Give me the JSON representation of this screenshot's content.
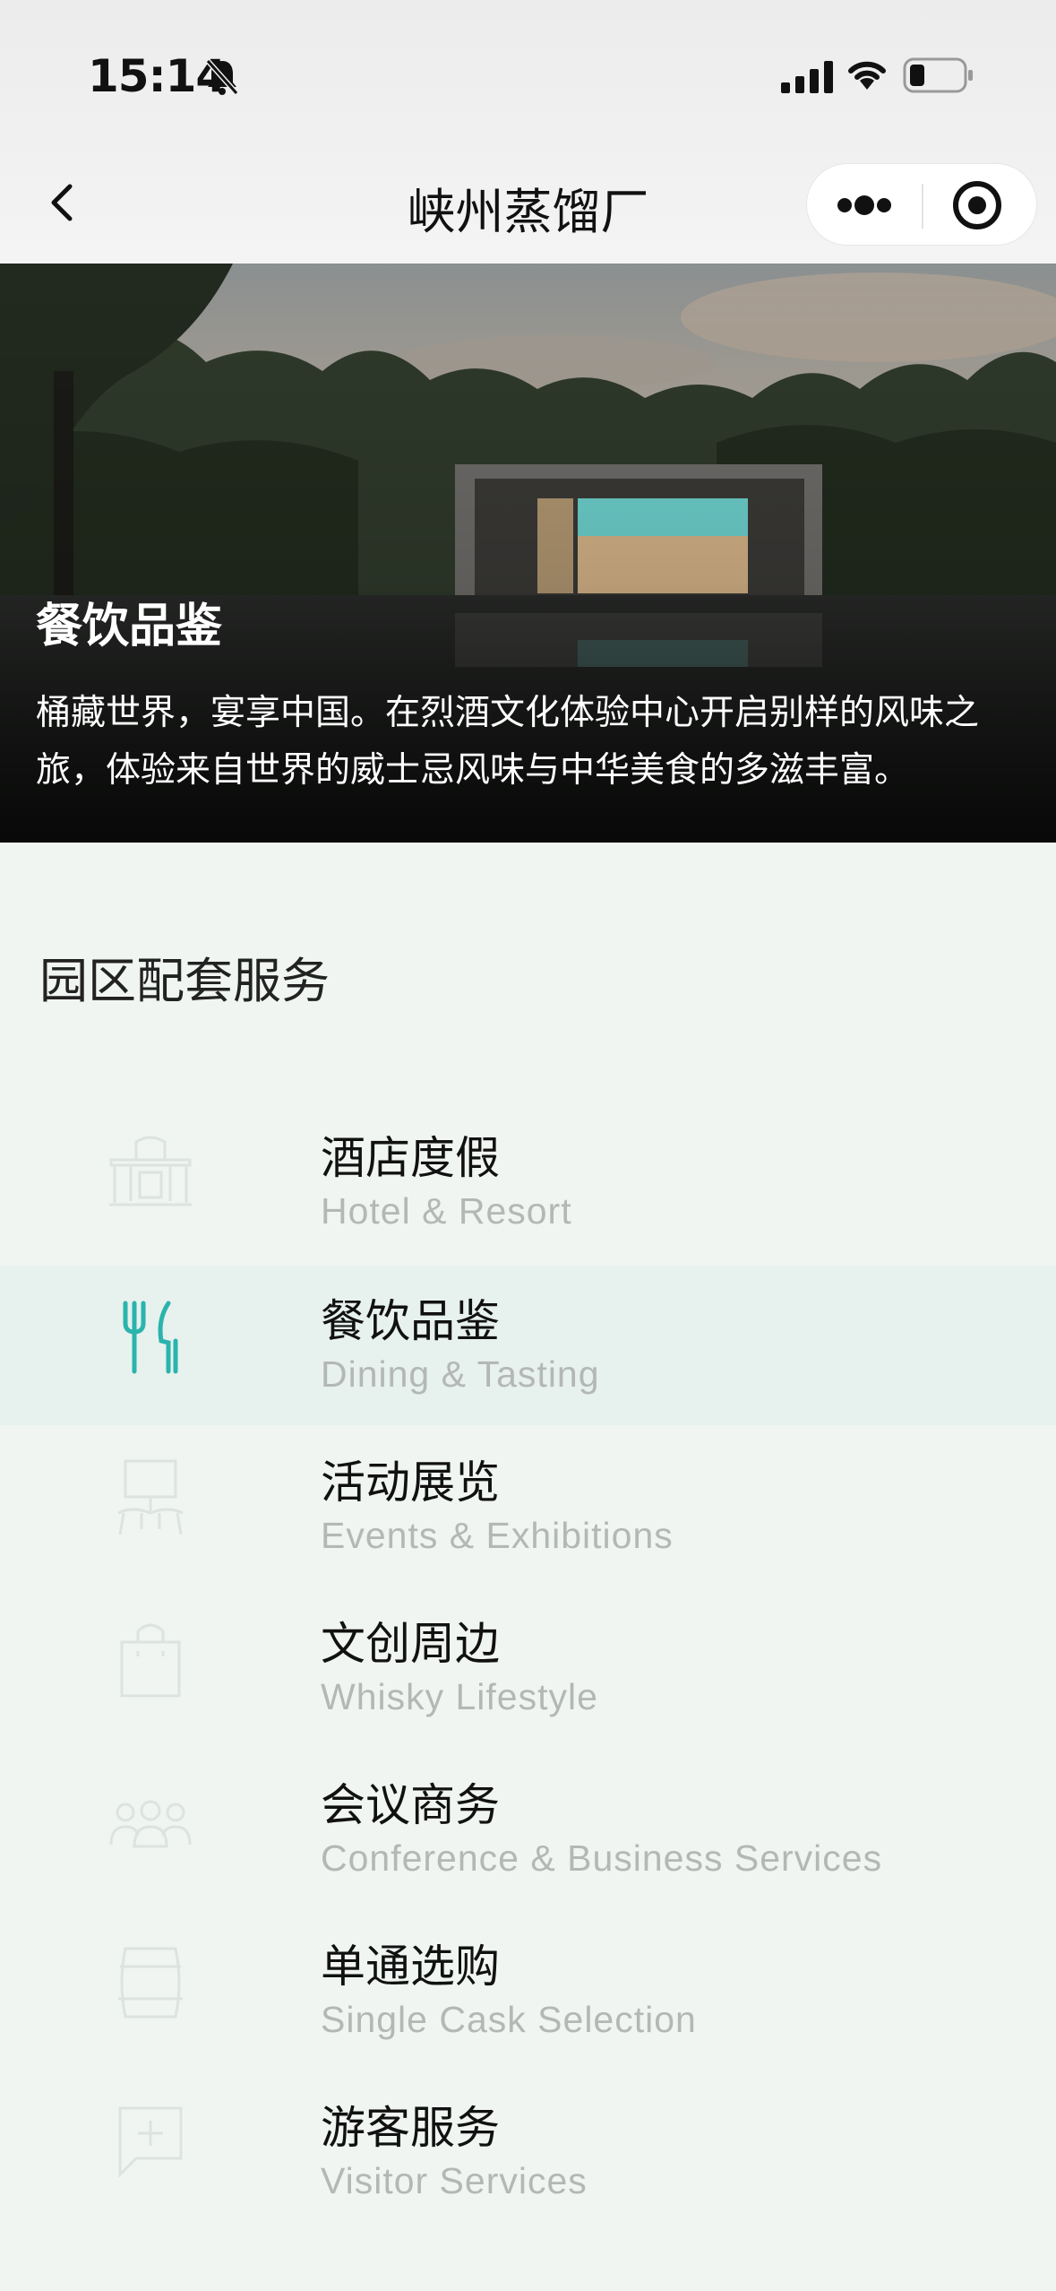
{
  "status_bar": {
    "time": "15:14"
  },
  "nav": {
    "title": "峡州蒸馏厂"
  },
  "hero": {
    "title": "餐饮品鉴",
    "description": "桶藏世界，宴享中国。在烈酒文化体验中心开启别样的风味之旅，体验来自世界的威士忌风味与中华美食的多滋丰富。"
  },
  "section": {
    "title": "园区配套服务"
  },
  "services": [
    {
      "cn": "酒店度假",
      "en": "Hotel & Resort",
      "icon": "hotel-icon",
      "active": false
    },
    {
      "cn": "餐饮品鉴",
      "en": "Dining & Tasting",
      "icon": "fork-knife-icon",
      "active": true
    },
    {
      "cn": "活动展览",
      "en": "Events & Exhibitions",
      "icon": "exhibition-icon",
      "active": false
    },
    {
      "cn": "文创周边",
      "en": "Whisky Lifestyle",
      "icon": "shopping-bag-icon",
      "active": false
    },
    {
      "cn": "会议商务",
      "en": "Conference & Business Services",
      "icon": "people-icon",
      "active": false
    },
    {
      "cn": "单通选购",
      "en": "Single Cask Selection",
      "icon": "cask-icon",
      "active": false
    },
    {
      "cn": "游客服务",
      "en": "Visitor Services",
      "icon": "chat-plus-icon",
      "active": false
    }
  ],
  "colors": {
    "accent": "#2bb3ad",
    "background": "#f0f5f1",
    "active_row": "#e7f1ed",
    "muted_icon": "#dce3e0"
  }
}
